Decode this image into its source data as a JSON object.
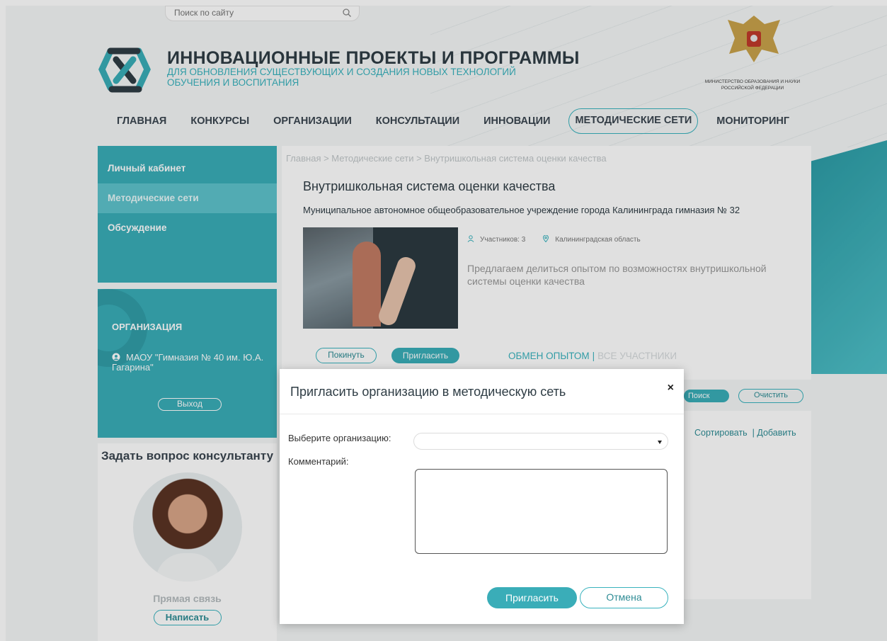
{
  "header": {
    "search_placeholder": "Поиск по сайту",
    "title": "ИННОВАЦИОННЫЕ ПРОЕКТЫ И ПРОГРАММЫ",
    "subtitle": "ДЛЯ ОБНОВЛЕНИЯ СУЩЕСТВУЮЩИХ И СОЗДАНИЯ НОВЫХ ТЕХНОЛОГИЙ ОБУЧЕНИЯ И ВОСПИТАНИЯ",
    "ministry": "МИНИСТЕРСТВО ОБРАЗОВАНИЯ И НАУКИ РОССИЙСКОЙ ФЕДЕРАЦИИ"
  },
  "nav": {
    "items": [
      "ГЛАВНАЯ",
      "КОНКУРСЫ",
      "ОРГАНИЗАЦИИ",
      "КОНСУЛЬТАЦИИ",
      "ИННОВАЦИИ",
      "МЕТОДИЧЕСКИЕ СЕТИ",
      "МОНИТОРИНГ"
    ],
    "active": "МЕТОДИЧЕСКИЕ СЕТИ"
  },
  "sidebar": {
    "items": [
      "Личный кабинет",
      "Методические сети",
      "Обсуждение"
    ],
    "org_title": "ОРГАНИЗАЦИЯ",
    "org_name": "МАОУ \"Гимназия № 40 им. Ю.А. Гагарина\"",
    "logout": "Выход",
    "ask_title": "Задать вопрос консультанту",
    "direct_link": "Прямая связь",
    "write": "Написать"
  },
  "main": {
    "breadcrumb": "Главная  >  Методические сети  >  Внутришкольная система оценки качества",
    "title": "Внутришкольная система оценки качества",
    "organization": "Муниципальное автономное общеобразовательное учреждение города Калининграда гимназия № 32",
    "participants": "Участников: 3",
    "region": "Калининградская область",
    "description": "Предлагаем делиться опытом по возможностях внутришкольной системы оценки качества",
    "leave": "Покинуть",
    "invite": "Пригласить",
    "tab_exchange": "ОБМЕН ОПЫТОМ",
    "tab_separator": "|",
    "tab_all": "ВСЕ УЧАСТНИКИ",
    "search": "Поиск",
    "clear": "Очистить",
    "sort": "Сортировать",
    "add": "Добавить"
  },
  "modal": {
    "title": "Пригласить организацию в методическую сеть",
    "close": "×",
    "org_label": "Выберите организацию:",
    "org_value": "",
    "comment_label": "Комментарий:",
    "comment_value": "",
    "invite": "Пригласить",
    "cancel": "Отмена"
  },
  "colors": {
    "accent": "#3aadb8",
    "text": "#2f3d45"
  }
}
